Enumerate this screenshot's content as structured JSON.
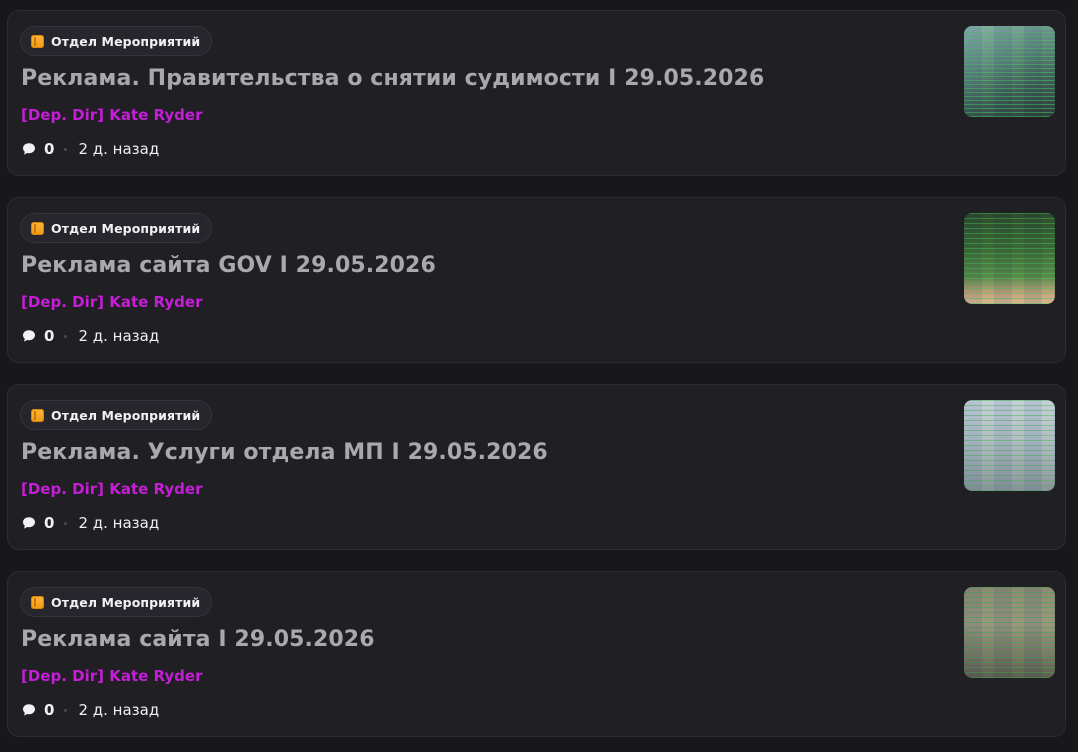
{
  "posts": [
    {
      "tag": "Отдел Мероприятий",
      "title": "Реклама. Правительства о снятии судимости I 29.05.2026",
      "author": "[Dep. Dir] Kate Ryder",
      "comments": "0",
      "time": "2 д. назад"
    },
    {
      "tag": "Отдел Мероприятий",
      "title": "Реклама сайта GOV I 29.05.2026",
      "author": "[Dep. Dir] Kate Ryder",
      "comments": "0",
      "time": "2 д. назад"
    },
    {
      "tag": "Отдел Мероприятий",
      "title": "Реклама. Услуги отдела МП I 29.05.2026",
      "author": "[Dep. Dir] Kate Ryder",
      "comments": "0",
      "time": "2 д. назад"
    },
    {
      "tag": "Отдел Мероприятий",
      "title": "Реклама сайта I 29.05.2026",
      "author": "[Dep. Dir] Kate Ryder",
      "comments": "0",
      "time": "2 д. назад"
    }
  ],
  "icons": {
    "tag": "folder-icon",
    "comments": "speech-bubble-icon"
  },
  "colors": {
    "background": "#18181c",
    "card": "#1f1f24",
    "title": "#a8a8ad",
    "author": "#c51ed6",
    "tag_icon": "#f39a12"
  }
}
